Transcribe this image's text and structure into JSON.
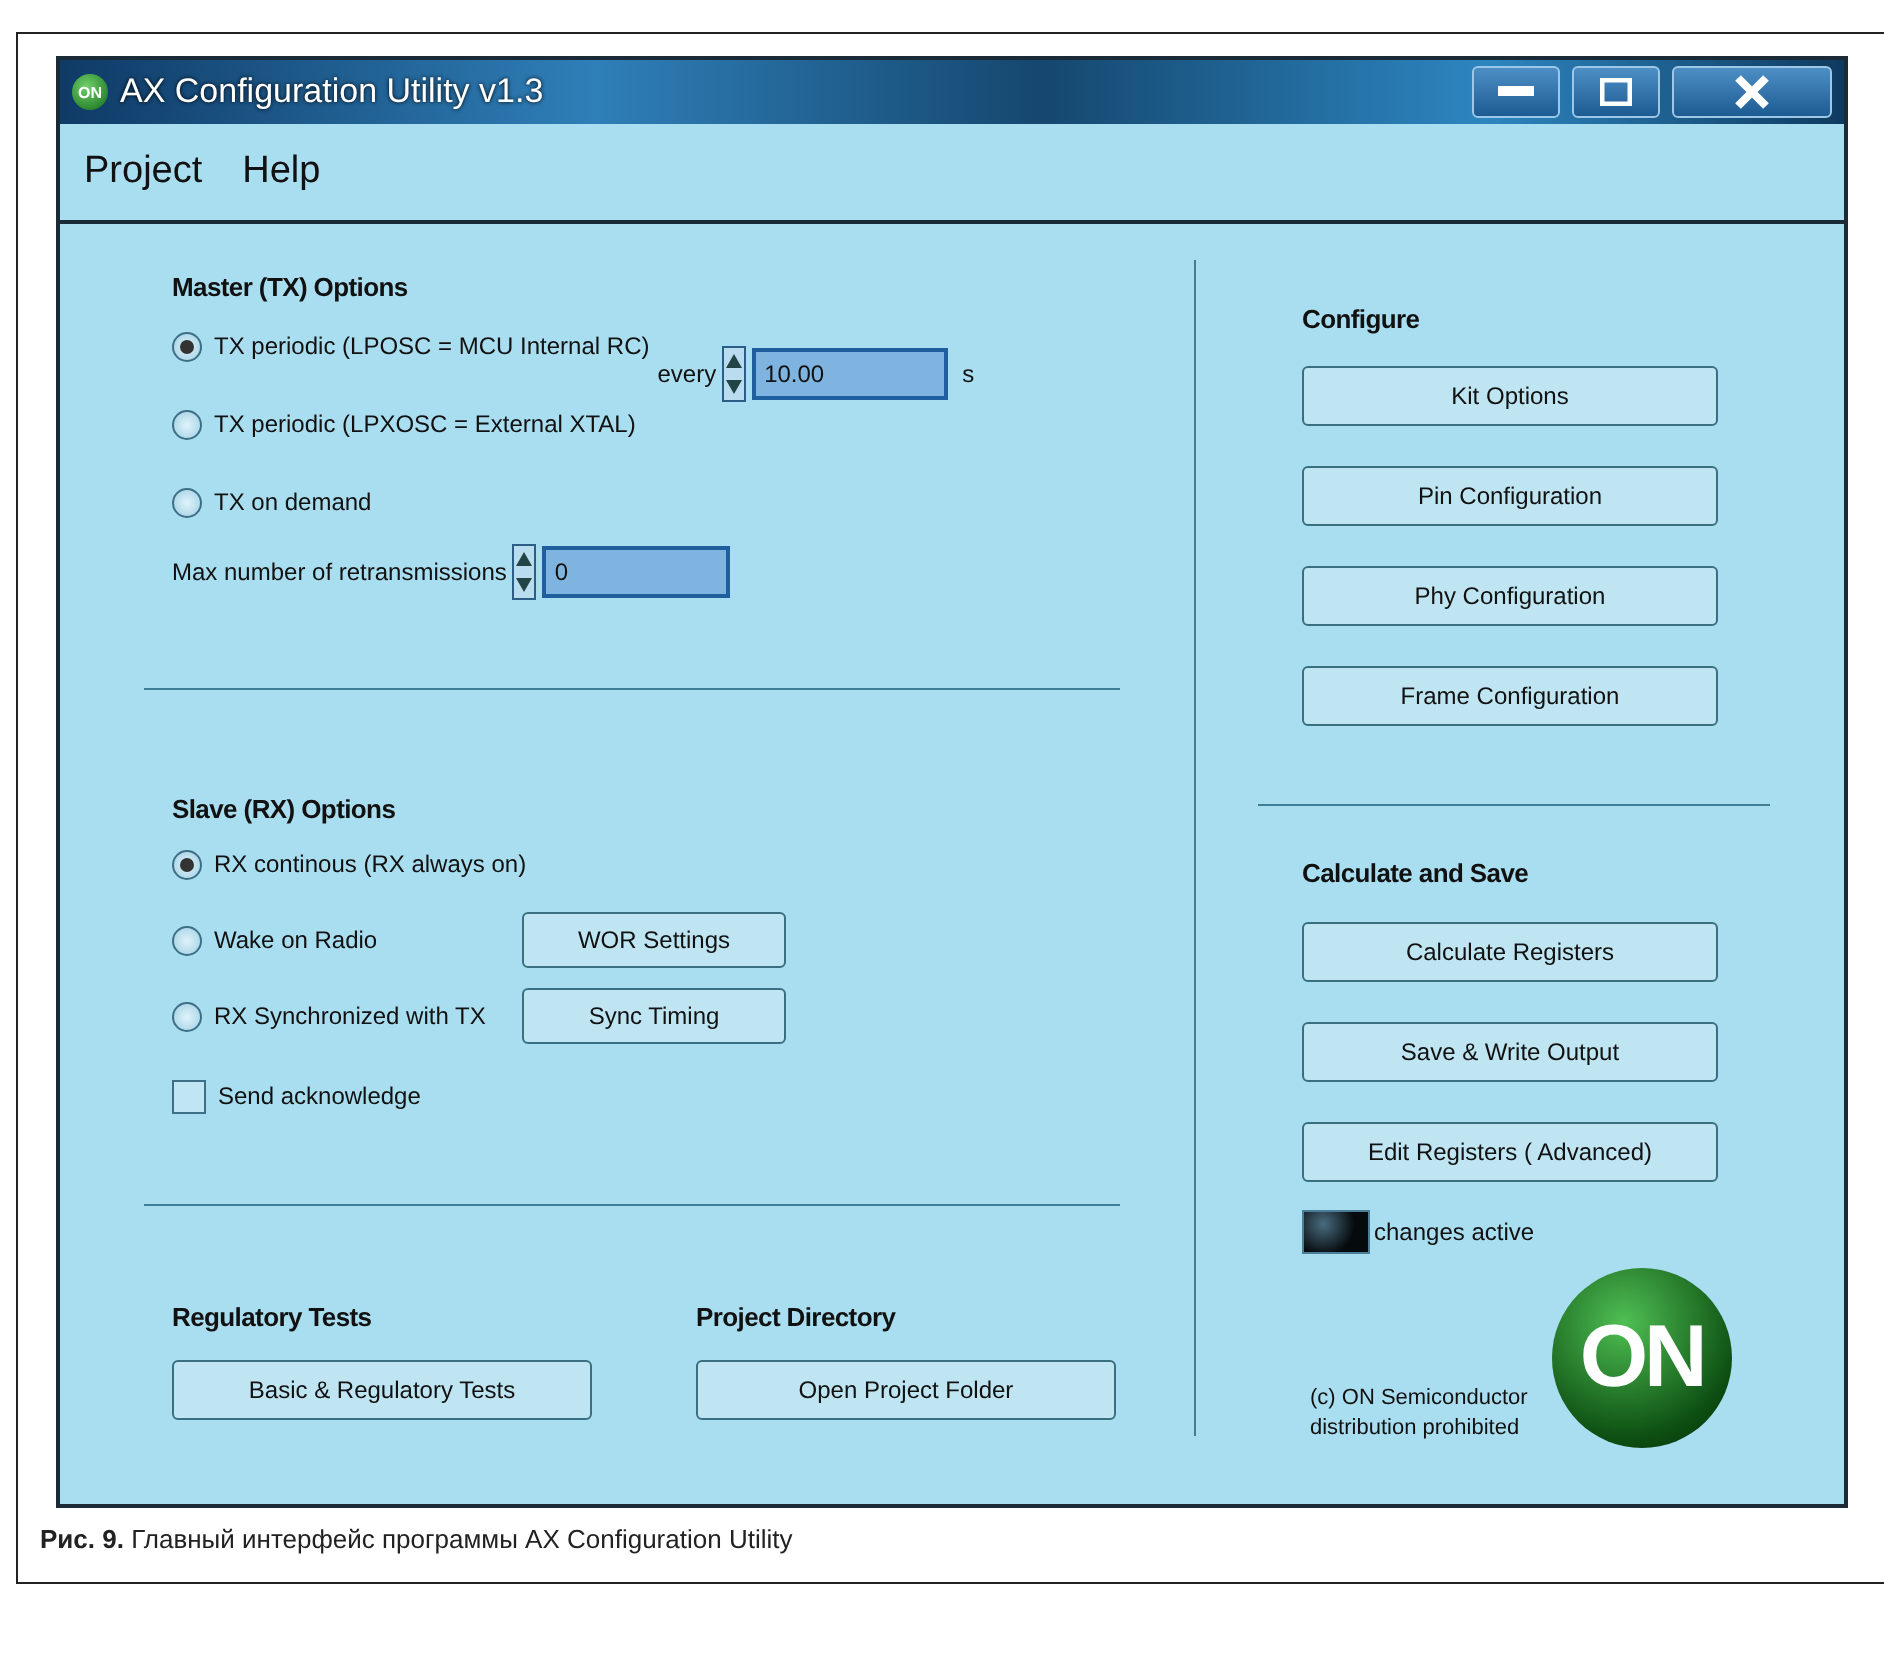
{
  "window": {
    "title": "AX Configuration Utility v1.3",
    "icon_text": "ON"
  },
  "menu": [
    {
      "label": "Project"
    },
    {
      "label": "Help"
    }
  ],
  "master": {
    "title": "Master (TX) Options",
    "options": [
      {
        "label": "TX periodic (LPOSC = MCU Internal RC)",
        "selected": true
      },
      {
        "label": "TX periodic (LPXOSC = External XTAL)",
        "selected": false
      },
      {
        "label": "TX on demand",
        "selected": false
      }
    ],
    "interval": {
      "label": "every",
      "value": "10.00",
      "unit": "s"
    },
    "retransmissions": {
      "label": "Max number of retransmissions",
      "value": "0"
    }
  },
  "slave": {
    "title": "Slave (RX) Options",
    "options": [
      {
        "label": "RX continous (RX always on)",
        "selected": true
      },
      {
        "label": "Wake on Radio",
        "selected": false,
        "button": "WOR Settings"
      },
      {
        "label": "RX Synchronized with TX",
        "selected": false,
        "button": "Sync Timing"
      }
    ],
    "acknowledge": {
      "label": "Send acknowledge",
      "checked": false
    }
  },
  "regulatory": {
    "title": "Regulatory Tests",
    "button": "Basic & Regulatory Tests"
  },
  "project_directory": {
    "title": "Project Directory",
    "button": "Open Project Folder"
  },
  "configure": {
    "title": "Configure",
    "buttons": [
      "Kit Options",
      "Pin Configuration",
      "Phy Configuration",
      "Frame Configuration"
    ]
  },
  "calculate": {
    "title": "Calculate and Save",
    "buttons": [
      "Calculate Registers",
      "Save & Write Output",
      "Edit Registers ( Advanced)"
    ],
    "indicator": {
      "label": "changes active",
      "on": false
    }
  },
  "copyright": [
    "(c) ON Semiconductor",
    "distribution prohibited"
  ],
  "logo": {
    "text": "ON"
  },
  "caption": "**Рис. 9.** Главный интерфейс программы AX Configuration Utility"
}
